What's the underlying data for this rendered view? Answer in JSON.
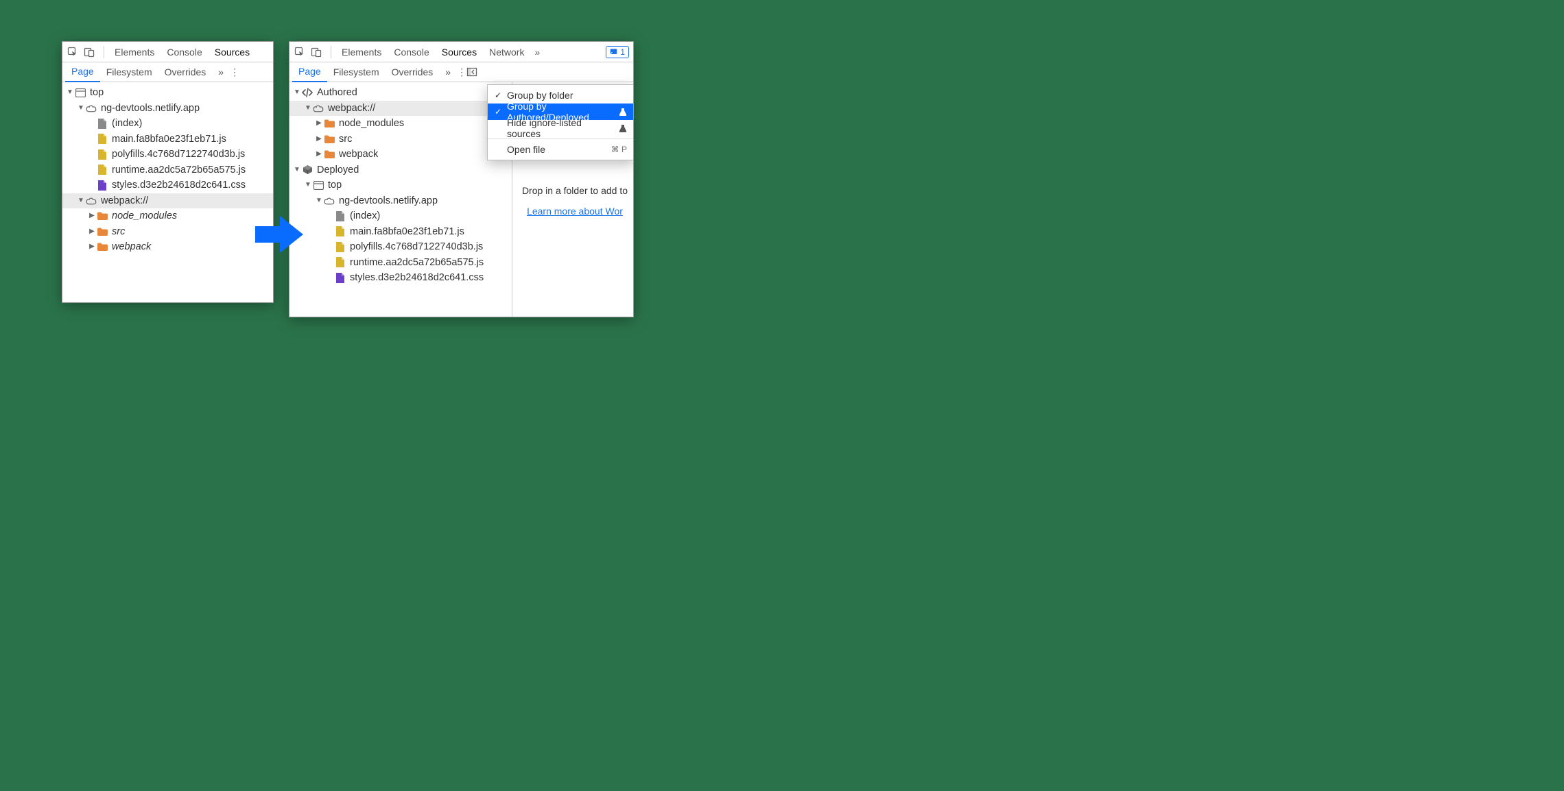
{
  "left": {
    "toolbar": {
      "tabs": [
        "Elements",
        "Console",
        "Sources"
      ],
      "active": "Sources"
    },
    "subbar": {
      "tabs": [
        "Page",
        "Filesystem",
        "Overrides"
      ],
      "active": "Page"
    },
    "tree": [
      {
        "d": 0,
        "arrow": "down",
        "icon": "window",
        "label": "top"
      },
      {
        "d": 1,
        "arrow": "down",
        "icon": "cloud",
        "label": "ng-devtools.netlify.app"
      },
      {
        "d": 2,
        "arrow": "",
        "icon": "doc-gray",
        "label": "(index)"
      },
      {
        "d": 2,
        "arrow": "",
        "icon": "doc-js",
        "label": "main.fa8bfa0e23f1eb71.js"
      },
      {
        "d": 2,
        "arrow": "",
        "icon": "doc-js",
        "label": "polyfills.4c768d7122740d3b.js"
      },
      {
        "d": 2,
        "arrow": "",
        "icon": "doc-js",
        "label": "runtime.aa2dc5a72b65a575.js"
      },
      {
        "d": 2,
        "arrow": "",
        "icon": "doc-css",
        "label": "styles.d3e2b24618d2c641.css"
      },
      {
        "d": 1,
        "arrow": "down",
        "icon": "cloud",
        "label": "webpack://",
        "sel": true
      },
      {
        "d": 2,
        "arrow": "right",
        "icon": "folder",
        "label": "node_modules",
        "italic": true
      },
      {
        "d": 2,
        "arrow": "right",
        "icon": "folder",
        "label": "src",
        "italic": true
      },
      {
        "d": 2,
        "arrow": "right",
        "icon": "folder",
        "label": "webpack",
        "italic": true
      }
    ]
  },
  "right": {
    "toolbar": {
      "tabs": [
        "Elements",
        "Console",
        "Sources",
        "Network"
      ],
      "active": "Sources",
      "moreCount": "1"
    },
    "subbar": {
      "tabs": [
        "Page",
        "Filesystem",
        "Overrides"
      ],
      "active": "Page"
    },
    "tree": [
      {
        "d": 0,
        "arrow": "down",
        "icon": "code",
        "label": "Authored"
      },
      {
        "d": 1,
        "arrow": "down",
        "icon": "cloud",
        "label": "webpack://",
        "sel": true
      },
      {
        "d": 2,
        "arrow": "right",
        "icon": "folder",
        "label": "node_modules"
      },
      {
        "d": 2,
        "arrow": "right",
        "icon": "folder",
        "label": "src"
      },
      {
        "d": 2,
        "arrow": "right",
        "icon": "folder",
        "label": "webpack"
      },
      {
        "d": 0,
        "arrow": "down",
        "icon": "cube",
        "label": "Deployed"
      },
      {
        "d": 1,
        "arrow": "down",
        "icon": "window",
        "label": "top"
      },
      {
        "d": 2,
        "arrow": "down",
        "icon": "cloud",
        "label": "ng-devtools.netlify.app"
      },
      {
        "d": 3,
        "arrow": "",
        "icon": "doc-gray",
        "label": "(index)"
      },
      {
        "d": 3,
        "arrow": "",
        "icon": "doc-js",
        "label": "main.fa8bfa0e23f1eb71.js"
      },
      {
        "d": 3,
        "arrow": "",
        "icon": "doc-js",
        "label": "polyfills.4c768d7122740d3b.js"
      },
      {
        "d": 3,
        "arrow": "",
        "icon": "doc-js",
        "label": "runtime.aa2dc5a72b65a575.js"
      },
      {
        "d": 3,
        "arrow": "",
        "icon": "doc-css",
        "label": "styles.d3e2b24618d2c641.css"
      }
    ],
    "menu": {
      "items": [
        {
          "label": "Group by folder",
          "checked": true
        },
        {
          "label": "Group by Authored/Deployed",
          "checked": true,
          "hl": true,
          "flask": true
        },
        {
          "label": "Hide ignore-listed sources",
          "checked": false,
          "flask": true
        },
        {
          "sep": true
        },
        {
          "label": "Open file",
          "shortcut": "⌘ P"
        }
      ]
    },
    "pane": {
      "drop": "Drop in a folder to add to",
      "learn": "Learn more about Wor"
    }
  }
}
